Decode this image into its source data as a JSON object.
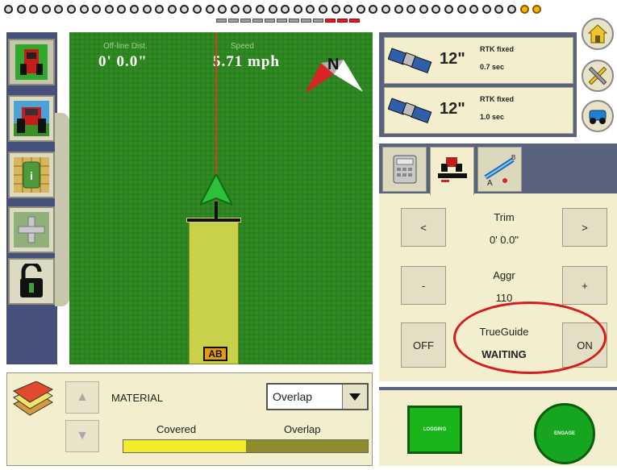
{
  "map": {
    "offline_label": "Off-line Dist.",
    "offline_value": "0' 0.0\"",
    "speed_label": "Speed",
    "speed_value": "5.71 mph",
    "compass_label": "N",
    "ab_label": "AB"
  },
  "gps": {
    "rows": [
      {
        "accuracy": "12\"",
        "mode": "RTK fixed",
        "age": "0.7 sec"
      },
      {
        "accuracy": "12\"",
        "mode": "RTK fixed",
        "age": "1.0 sec"
      }
    ]
  },
  "steering": {
    "trim_label": "Trim",
    "trim_value": "0' 0.0\"",
    "trim_left": "<",
    "trim_right": ">",
    "aggr_label": "Aggr",
    "aggr_value": "110",
    "aggr_minus": "-",
    "aggr_plus": "+",
    "trueguide_label": "TrueGuide",
    "trueguide_status": "WAITING",
    "off_label": "OFF",
    "on_label": "ON"
  },
  "coverage": {
    "material_label": "MATERIAL",
    "material_value": "Overlap",
    "covered_label": "Covered",
    "overlap_label": "Overlap",
    "covered_fraction": 0.5
  },
  "buttons": {
    "logging_label": "LOGGING",
    "engage_label": "ENGAGE"
  },
  "colors": {
    "accent_red": "#d21e1e",
    "map_green": "#2f8a22",
    "panel_bg": "#f3eecd"
  }
}
